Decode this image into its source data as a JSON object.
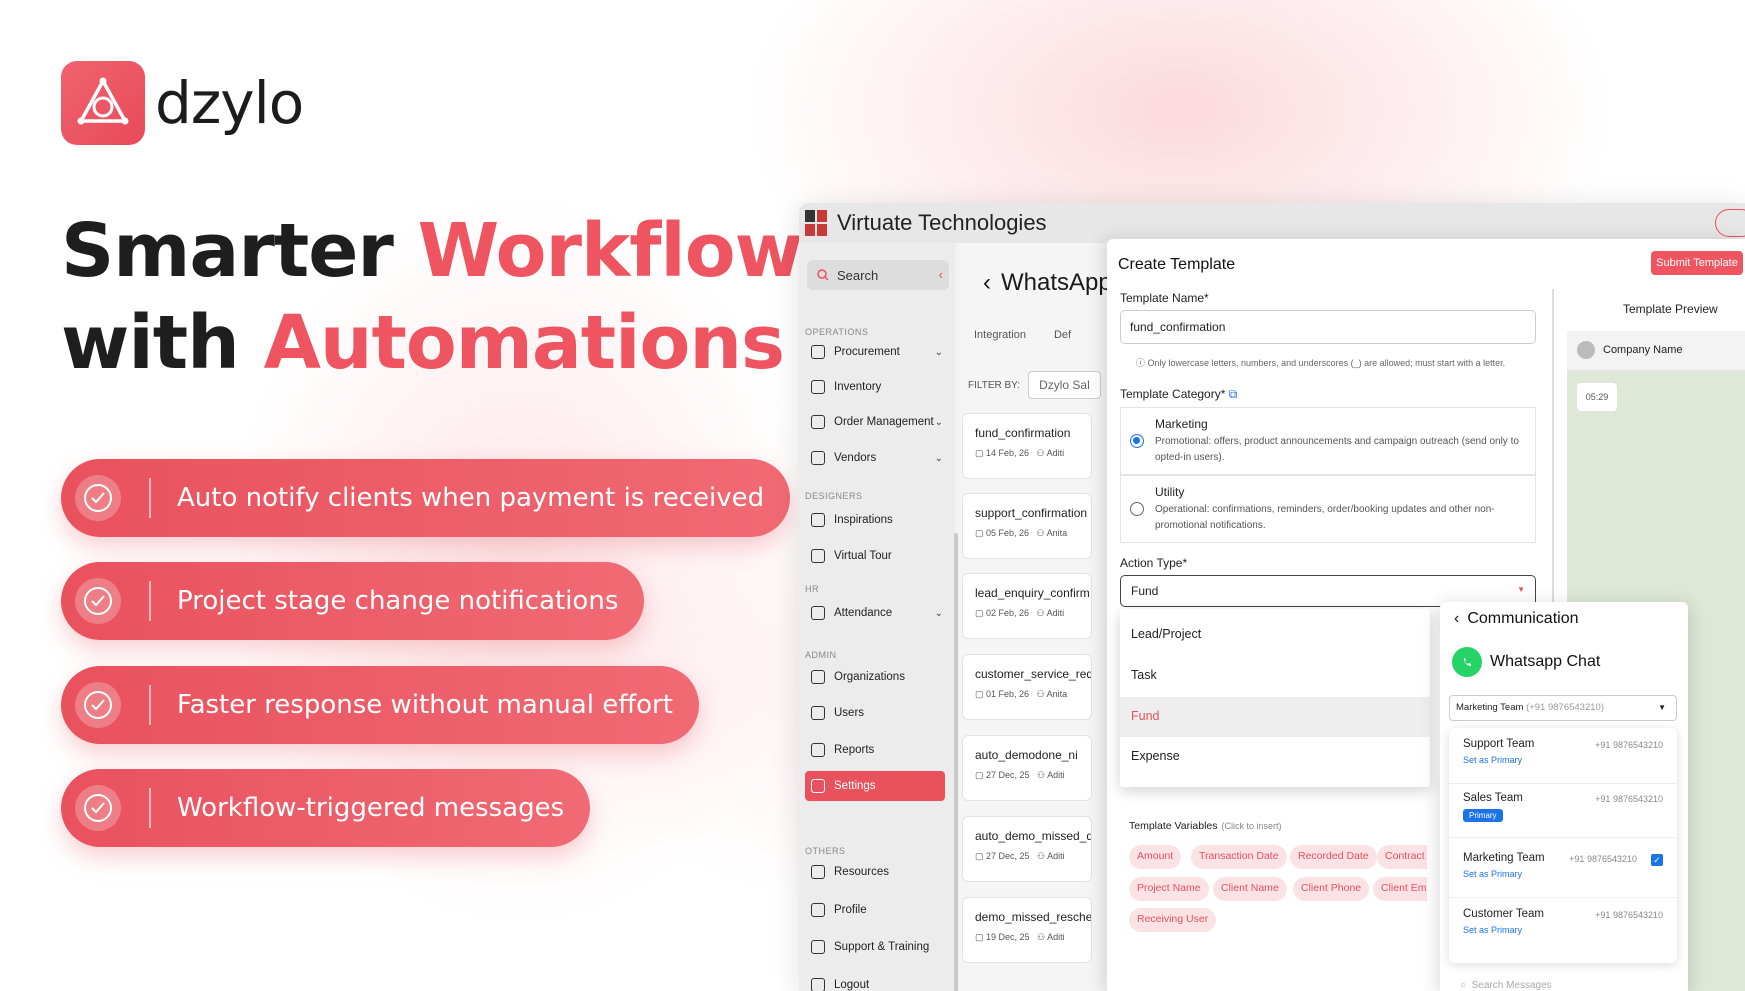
{
  "brand": {
    "name": "dzylo",
    "accent": "#ef5561"
  },
  "headline": {
    "line1_plain": "Smarter",
    "line1_accent": "Workflow",
    "line2_plain": "with",
    "line2_accent": "Automations"
  },
  "features": [
    "Auto notify clients when payment is received",
    "Project stage change notifications",
    "Faster response without manual effort",
    "Workflow-triggered messages"
  ],
  "app": {
    "company": "Virtuate Technologies",
    "search_placeholder": "Search",
    "sidebar": {
      "sections": [
        "OPERATIONS",
        "DESIGNERS",
        "HR",
        "ADMIN",
        "OTHERS"
      ],
      "items": [
        "Procurement",
        "Inventory",
        "Order Management",
        "Vendors",
        "Inspirations",
        "Virtual Tour",
        "Attendance",
        "Organizations",
        "Users",
        "Reports",
        "Settings",
        "Resources",
        "Profile",
        "Support & Training",
        "Logout"
      ]
    },
    "page": {
      "title": "WhatsApp",
      "tabs": [
        "Integration",
        "Def"
      ],
      "filter_label": "FILTER BY:",
      "filter_value": "Dzylo Sal",
      "cards": [
        {
          "name": "fund_confirmation",
          "date": "14 Feb, 26",
          "user": "Aditi"
        },
        {
          "name": "support_confirmation",
          "date": "05 Feb, 26",
          "user": "Anita"
        },
        {
          "name": "lead_enquiry_confirm",
          "date": "02 Feb, 26",
          "user": "Aditi"
        },
        {
          "name": "customer_service_req",
          "date": "01 Feb, 26",
          "user": "Anita"
        },
        {
          "name": "auto_demodone_ni",
          "date": "27 Dec, 25",
          "user": "Aditi"
        },
        {
          "name": "auto_demo_missed_d",
          "date": "27 Dec, 25",
          "user": "Aditi"
        },
        {
          "name": "demo_missed_resched",
          "date": "19 Dec, 25",
          "user": "Aditi"
        }
      ]
    },
    "modal": {
      "title": "Create Template",
      "submit": "Submit Template",
      "name_label": "Template Name*",
      "name_value": "fund_confirmation",
      "name_hint": "Only lowercase letters, numbers, and underscores (_) are allowed; must start with a letter.",
      "category_label": "Template Category*",
      "categories": [
        {
          "name": "Marketing",
          "desc": "Promotional: offers, product announcements and campaign outreach (send only to opted-in users)."
        },
        {
          "name": "Utility",
          "desc": "Operational: confirmations, reminders, order/booking updates and other non-promotional notifications."
        }
      ],
      "action_label": "Action Type*",
      "action_value": "Fund",
      "action_options": [
        "Lead/Project",
        "Task",
        "Fund",
        "Expense"
      ],
      "variables_label": "Template Variables",
      "variables_hint": "(Click to insert)",
      "variables": [
        "Amount",
        "Transaction Date",
        "Recorded Date",
        "Contract N",
        "Project Name",
        "Client Name",
        "Client Phone",
        "Client Emai",
        "Receiving User"
      ],
      "preview_title": "Template Preview",
      "preview_company": "Company Name",
      "preview_time": "05:29"
    },
    "communication": {
      "title": "Communication",
      "channel": "Whatsapp Chat",
      "selected_team": "Marketing Team",
      "selected_phone": "(+91 9876543210)",
      "teams": [
        {
          "name": "Support Team",
          "phone": "+91 9876543210",
          "action": "Set as Primary"
        },
        {
          "name": "Sales Team",
          "phone": "+91 9876543210",
          "badge": "Primary"
        },
        {
          "name": "Marketing Team",
          "phone": "+91 9876543210",
          "action": "Set as Primary"
        },
        {
          "name": "Customer Team",
          "phone": "+91 9876543210",
          "action": "Set as Primary"
        }
      ],
      "search_placeholder": "Search Messages"
    }
  }
}
